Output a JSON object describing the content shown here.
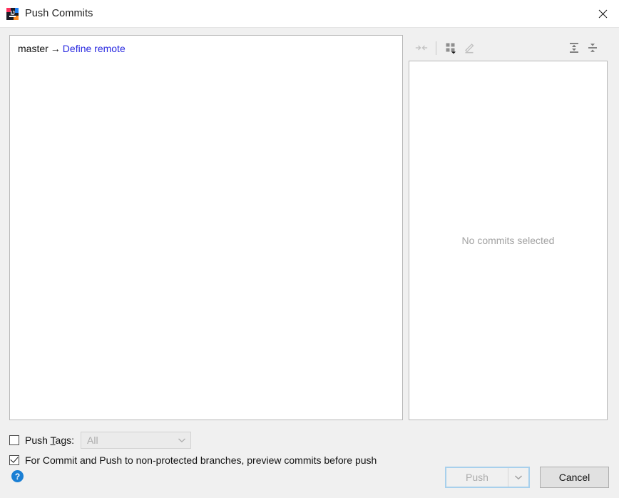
{
  "window": {
    "title": "Push Commits",
    "app_icon": "intellij-idea-icon",
    "close_label": "✕"
  },
  "branch": {
    "source": "master",
    "arrow": "→",
    "target_link": "Define remote"
  },
  "toolbar": {
    "buttons": [
      {
        "name": "collapse-selection-icon",
        "label": "Collapse Selection",
        "enabled": false
      },
      {
        "name": "group-by-icon",
        "label": "Group By",
        "enabled": true
      },
      {
        "name": "edit-icon",
        "label": "Edit",
        "enabled": false
      },
      {
        "name": "expand-all-icon",
        "label": "Expand All",
        "enabled": true
      },
      {
        "name": "collapse-all-icon",
        "label": "Collapse All",
        "enabled": true
      }
    ]
  },
  "details_panel": {
    "empty_message": "No commits selected"
  },
  "options": {
    "push_tags": {
      "label_before": "Push ",
      "label_mnemonic": "T",
      "label_after": "ags:",
      "checked": false,
      "combo_value": "All",
      "combo_enabled": false
    },
    "preview_commits": {
      "label": "For Commit and Push to non-protected branches, preview commits before push",
      "checked": true
    }
  },
  "footer": {
    "help_label": "?",
    "push_label": "Push",
    "push_enabled": false,
    "push_dropdown": "chevron-down-icon",
    "cancel_label": "Cancel"
  },
  "colors": {
    "dialog_background": "#f0f0f0",
    "panel_background": "#ffffff",
    "panel_border": "#b8b8b8",
    "link": "#2a2ae0",
    "muted_text": "#a2a2a2",
    "help_blue": "#1a7fd4",
    "focus_border": "#a8d0ec"
  }
}
